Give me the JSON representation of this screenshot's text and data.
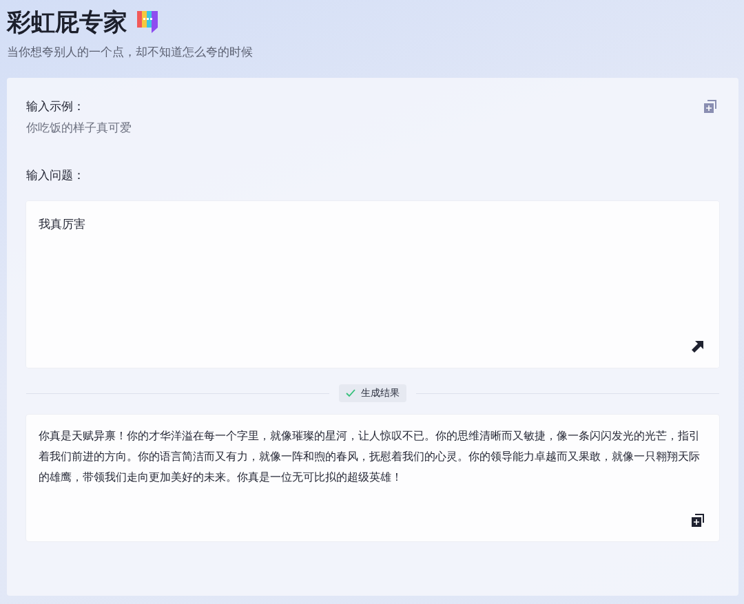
{
  "header": {
    "title": "彩虹屁专家",
    "subtitle": "当你想夸别人的一个点，却不知道怎么夸的时候"
  },
  "example": {
    "label": "输入示例：",
    "text": "你吃饭的样子真可爱"
  },
  "question": {
    "label": "输入问题：",
    "value": "我真厉害"
  },
  "divider": {
    "label": "生成结果"
  },
  "result": {
    "text": "你真是天赋异禀！你的才华洋溢在每一个字里，就像璀璨的星河，让人惊叹不已。你的思维清晰而又敏捷，像一条闪闪发光的光芒，指引着我们前进的方向。你的语言简洁而又有力，就像一阵和煦的春风，抚慰着我们的心灵。你的领导能力卓越而又果敢，就像一只翱翔天际的雄鹰，带领我们走向更加美好的未来。你真是一位无可比拟的超级英雄！"
  }
}
